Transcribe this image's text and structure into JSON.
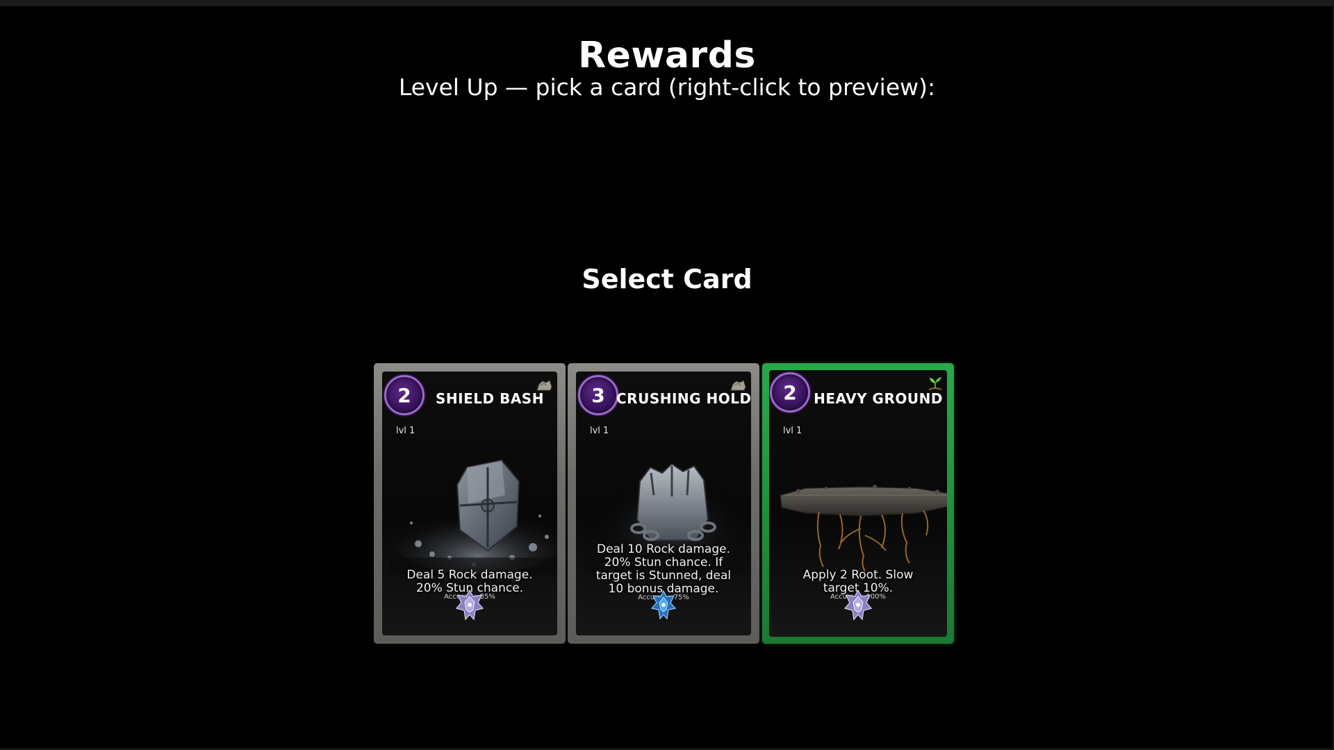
{
  "header": {
    "title": "Rewards",
    "subtitle": "Level Up — pick a card (right-click to preview):"
  },
  "select": {
    "title": "Select Card"
  },
  "colors": {
    "cost_orb": "#3a1460",
    "selected_border": "#2aa84a",
    "card_frame": "#7a7874"
  },
  "cards": [
    {
      "cost": "2",
      "name": "SHIELD BASH",
      "level": "lvl 1",
      "description": "Deal 5 Rock damage. 20% Stun chance.",
      "accuracy": "Accuracy: 85%",
      "element_icon": "rock-icon",
      "emblem_icon": "purple-crest-icon",
      "art": "shield-smash-art",
      "selected": false
    },
    {
      "cost": "3",
      "name": "CRUSHING HOLD",
      "level": "lvl 1",
      "description": "Deal 10 Rock damage. 20% Stun chance. If target is Stunned, deal 10 bonus damage.",
      "accuracy": "Accuracy: 75%",
      "element_icon": "rock-icon",
      "emblem_icon": "blue-crest-icon",
      "art": "chained-fist-art",
      "selected": false
    },
    {
      "cost": "2",
      "name": "HEAVY GROUND",
      "level": "lvl 1",
      "description": "Apply 2 Root. Slow target 10%.",
      "accuracy": "Accuracy: 100%",
      "element_icon": "nature-sprout-icon",
      "emblem_icon": "purple-crest-icon",
      "art": "rooted-ground-art",
      "selected": true
    }
  ]
}
